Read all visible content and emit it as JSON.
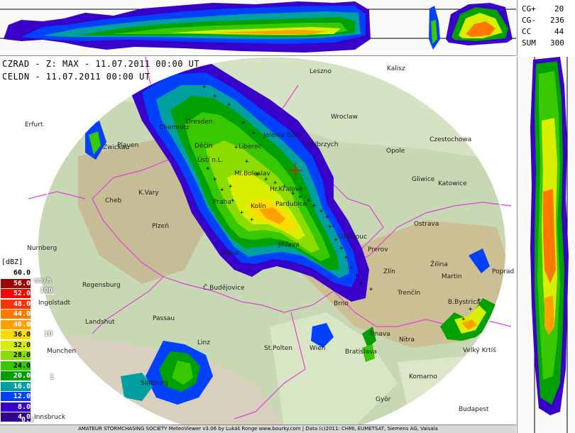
{
  "header": {
    "line1": "CZRAD - Z: MAX - 11.07.2011 00:00 UT",
    "line2": "CELDN - 11.07.2011 00:00 UT"
  },
  "lightning": [
    {
      "label": "CG+",
      "value": "20"
    },
    {
      "label": "CG-",
      "value": "236"
    },
    {
      "label": "CC",
      "value": "44"
    },
    {
      "label": "SUM",
      "value": "300"
    }
  ],
  "legend": {
    "unit": "[dBZ]",
    "rain_unit": "mm/h",
    "levels": [
      {
        "dbz": "60.0",
        "color": "#ffffff",
        "text": "#000000"
      },
      {
        "dbz": "56.0",
        "color": "#a00000",
        "text": "#ffffff"
      },
      {
        "dbz": "52.0",
        "color": "#ff0000",
        "text": "#ffffff"
      },
      {
        "dbz": "48.0",
        "color": "#ff3000",
        "text": "#ffffff"
      },
      {
        "dbz": "44.0",
        "color": "#ff7800",
        "text": "#ffffff"
      },
      {
        "dbz": "40.0",
        "color": "#ffa000",
        "text": "#ffffff"
      },
      {
        "dbz": "36.0",
        "color": "#ffdc00",
        "text": "#000000"
      },
      {
        "dbz": "32.0",
        "color": "#d8f000",
        "text": "#000000"
      },
      {
        "dbz": "28.0",
        "color": "#8cdc00",
        "text": "#000000"
      },
      {
        "dbz": "24.0",
        "color": "#38c800",
        "text": "#000000"
      },
      {
        "dbz": "20.0",
        "color": "#00a000",
        "text": "#ffffff"
      },
      {
        "dbz": "16.0",
        "color": "#00a0a0",
        "text": "#ffffff"
      },
      {
        "dbz": "12.0",
        "color": "#0040ff",
        "text": "#ffffff"
      },
      {
        "dbz": "8.0",
        "color": "#3800c8",
        "text": "#ffffff"
      },
      {
        "dbz": "4.0",
        "color": "#300090",
        "text": "#ffffff"
      }
    ],
    "rain_rates": [
      "100",
      "10",
      "1",
      "0.1"
    ]
  },
  "cities": [
    "Leszno",
    "Kalisz",
    "Wroclaw",
    "Czestochowa",
    "Opole",
    "Gliwice",
    "Katowice",
    "Ostrava",
    "Olomouc",
    "Prerov",
    "Zlín",
    "Žilina",
    "Poprad",
    "Martin",
    "B.Bystrica",
    "Trenčín",
    "Trnava",
    "Nitra",
    "Velký Krtíš",
    "Bratislava",
    "Komarno",
    "Györ",
    "Budapest",
    "Wien",
    "St.Polten",
    "Linz",
    "Salzburg",
    "Innsbruck",
    "Munchen",
    "Landshut",
    "Passau",
    "Ingolstadt",
    "Regensburg",
    "Nurnberg",
    "Plzeň",
    "Cheb",
    "K.Vary",
    "Praha",
    "Kolín",
    "Pardubice",
    "Hr.Kralové",
    "Liberec",
    "Ústí n.L.",
    "Děčín",
    "Dresden",
    "Jelenia Gora",
    "Walbrzych",
    "Erfurt",
    "Plauen",
    "Chemnitz",
    "Č.Budějovice",
    "Tabor",
    "Brno",
    "Jihlava",
    "Zwickau",
    "Ml.Boleslav"
  ],
  "footer": "AMATEUR STORMCHASING SOCIETY MeteoViewer v3.06 by Lukáš Ronge www.bourky.com | Data (c)2011: CHMI, EUMETSAT, Siemens AG, Vaisala"
}
